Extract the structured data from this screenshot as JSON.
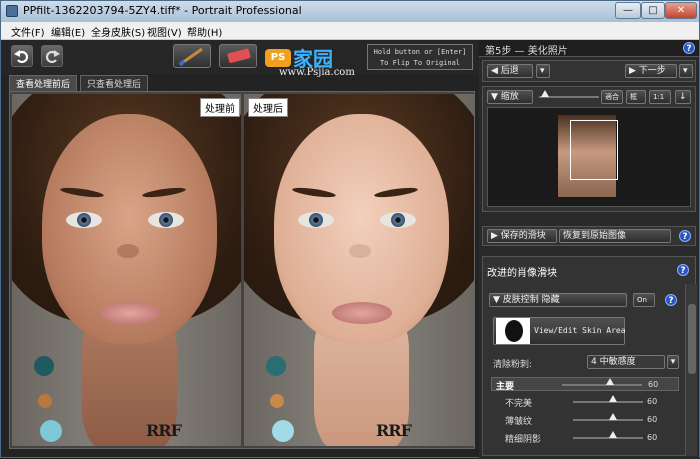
{
  "window": {
    "title": "PPfilt-1362203794-5ZY4.tiff* - Portrait Professional",
    "min": "—",
    "max": "□",
    "close": "✕"
  },
  "menu": [
    "文件(F)",
    "编辑(E)",
    "全身皮肤(S)",
    "视图(V)",
    "帮助(H)"
  ],
  "toolbar": {
    "undo": "undo-icon",
    "redo": "redo-icon",
    "brush": "brush-icon",
    "eraser": "eraser-icon",
    "flip_line1": "Hold button or [Enter]",
    "flip_line2": "To Flip To Original"
  },
  "logo": {
    "ps": "PS",
    "cn": "家园",
    "url": "www.Psjia.com"
  },
  "tabs": [
    "查看处理前后",
    "只查看处理后"
  ],
  "view": {
    "before_label": "处理前",
    "after_label": "处理后",
    "watermark": "RRF"
  },
  "right": {
    "step": "第5步 — 美化照片",
    "back": "后退",
    "next": "下一步",
    "zoom": "缩放",
    "zoom_btns": [
      "適合",
      "框",
      "1:1"
    ],
    "saved_sliders": "保存的滑块",
    "restore": "恢复到原始图像",
    "improved": "改进的肖像滑块",
    "skin": "皮肤控制 隐藏",
    "on": "On",
    "skin_area": "View/Edit Skin Area",
    "remove_powder": "清除粉刺:",
    "remove_value": "4 中敏感度",
    "sliders": [
      {
        "name": "主要",
        "value": "60"
      },
      {
        "name": "不完美",
        "value": "60"
      },
      {
        "name": "薄皱纹",
        "value": "60"
      },
      {
        "name": "精细阴影",
        "value": "60"
      }
    ],
    "help": "?"
  },
  "colors": {
    "accent": "#2a55c0",
    "titlebar": "#a9bfd6"
  }
}
